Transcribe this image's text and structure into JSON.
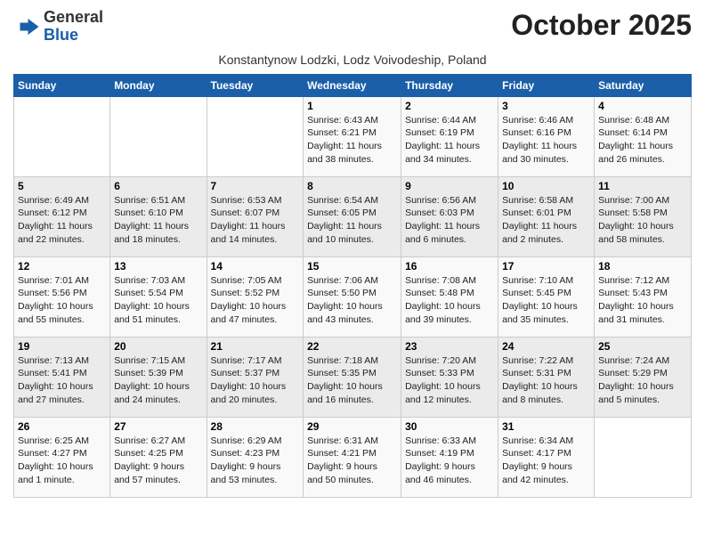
{
  "header": {
    "logo_line1": "General",
    "logo_line2": "Blue",
    "month_title": "October 2025",
    "subtitle": "Konstantynow Lodzki, Lodz Voivodeship, Poland"
  },
  "columns": [
    "Sunday",
    "Monday",
    "Tuesday",
    "Wednesday",
    "Thursday",
    "Friday",
    "Saturday"
  ],
  "weeks": [
    [
      {
        "day": "",
        "info": ""
      },
      {
        "day": "",
        "info": ""
      },
      {
        "day": "",
        "info": ""
      },
      {
        "day": "1",
        "info": "Sunrise: 6:43 AM\nSunset: 6:21 PM\nDaylight: 11 hours\nand 38 minutes."
      },
      {
        "day": "2",
        "info": "Sunrise: 6:44 AM\nSunset: 6:19 PM\nDaylight: 11 hours\nand 34 minutes."
      },
      {
        "day": "3",
        "info": "Sunrise: 6:46 AM\nSunset: 6:16 PM\nDaylight: 11 hours\nand 30 minutes."
      },
      {
        "day": "4",
        "info": "Sunrise: 6:48 AM\nSunset: 6:14 PM\nDaylight: 11 hours\nand 26 minutes."
      }
    ],
    [
      {
        "day": "5",
        "info": "Sunrise: 6:49 AM\nSunset: 6:12 PM\nDaylight: 11 hours\nand 22 minutes."
      },
      {
        "day": "6",
        "info": "Sunrise: 6:51 AM\nSunset: 6:10 PM\nDaylight: 11 hours\nand 18 minutes."
      },
      {
        "day": "7",
        "info": "Sunrise: 6:53 AM\nSunset: 6:07 PM\nDaylight: 11 hours\nand 14 minutes."
      },
      {
        "day": "8",
        "info": "Sunrise: 6:54 AM\nSunset: 6:05 PM\nDaylight: 11 hours\nand 10 minutes."
      },
      {
        "day": "9",
        "info": "Sunrise: 6:56 AM\nSunset: 6:03 PM\nDaylight: 11 hours\nand 6 minutes."
      },
      {
        "day": "10",
        "info": "Sunrise: 6:58 AM\nSunset: 6:01 PM\nDaylight: 11 hours\nand 2 minutes."
      },
      {
        "day": "11",
        "info": "Sunrise: 7:00 AM\nSunset: 5:58 PM\nDaylight: 10 hours\nand 58 minutes."
      }
    ],
    [
      {
        "day": "12",
        "info": "Sunrise: 7:01 AM\nSunset: 5:56 PM\nDaylight: 10 hours\nand 55 minutes."
      },
      {
        "day": "13",
        "info": "Sunrise: 7:03 AM\nSunset: 5:54 PM\nDaylight: 10 hours\nand 51 minutes."
      },
      {
        "day": "14",
        "info": "Sunrise: 7:05 AM\nSunset: 5:52 PM\nDaylight: 10 hours\nand 47 minutes."
      },
      {
        "day": "15",
        "info": "Sunrise: 7:06 AM\nSunset: 5:50 PM\nDaylight: 10 hours\nand 43 minutes."
      },
      {
        "day": "16",
        "info": "Sunrise: 7:08 AM\nSunset: 5:48 PM\nDaylight: 10 hours\nand 39 minutes."
      },
      {
        "day": "17",
        "info": "Sunrise: 7:10 AM\nSunset: 5:45 PM\nDaylight: 10 hours\nand 35 minutes."
      },
      {
        "day": "18",
        "info": "Sunrise: 7:12 AM\nSunset: 5:43 PM\nDaylight: 10 hours\nand 31 minutes."
      }
    ],
    [
      {
        "day": "19",
        "info": "Sunrise: 7:13 AM\nSunset: 5:41 PM\nDaylight: 10 hours\nand 27 minutes."
      },
      {
        "day": "20",
        "info": "Sunrise: 7:15 AM\nSunset: 5:39 PM\nDaylight: 10 hours\nand 24 minutes."
      },
      {
        "day": "21",
        "info": "Sunrise: 7:17 AM\nSunset: 5:37 PM\nDaylight: 10 hours\nand 20 minutes."
      },
      {
        "day": "22",
        "info": "Sunrise: 7:18 AM\nSunset: 5:35 PM\nDaylight: 10 hours\nand 16 minutes."
      },
      {
        "day": "23",
        "info": "Sunrise: 7:20 AM\nSunset: 5:33 PM\nDaylight: 10 hours\nand 12 minutes."
      },
      {
        "day": "24",
        "info": "Sunrise: 7:22 AM\nSunset: 5:31 PM\nDaylight: 10 hours\nand 8 minutes."
      },
      {
        "day": "25",
        "info": "Sunrise: 7:24 AM\nSunset: 5:29 PM\nDaylight: 10 hours\nand 5 minutes."
      }
    ],
    [
      {
        "day": "26",
        "info": "Sunrise: 6:25 AM\nSunset: 4:27 PM\nDaylight: 10 hours\nand 1 minute."
      },
      {
        "day": "27",
        "info": "Sunrise: 6:27 AM\nSunset: 4:25 PM\nDaylight: 9 hours\nand 57 minutes."
      },
      {
        "day": "28",
        "info": "Sunrise: 6:29 AM\nSunset: 4:23 PM\nDaylight: 9 hours\nand 53 minutes."
      },
      {
        "day": "29",
        "info": "Sunrise: 6:31 AM\nSunset: 4:21 PM\nDaylight: 9 hours\nand 50 minutes."
      },
      {
        "day": "30",
        "info": "Sunrise: 6:33 AM\nSunset: 4:19 PM\nDaylight: 9 hours\nand 46 minutes."
      },
      {
        "day": "31",
        "info": "Sunrise: 6:34 AM\nSunset: 4:17 PM\nDaylight: 9 hours\nand 42 minutes."
      },
      {
        "day": "",
        "info": ""
      }
    ]
  ]
}
